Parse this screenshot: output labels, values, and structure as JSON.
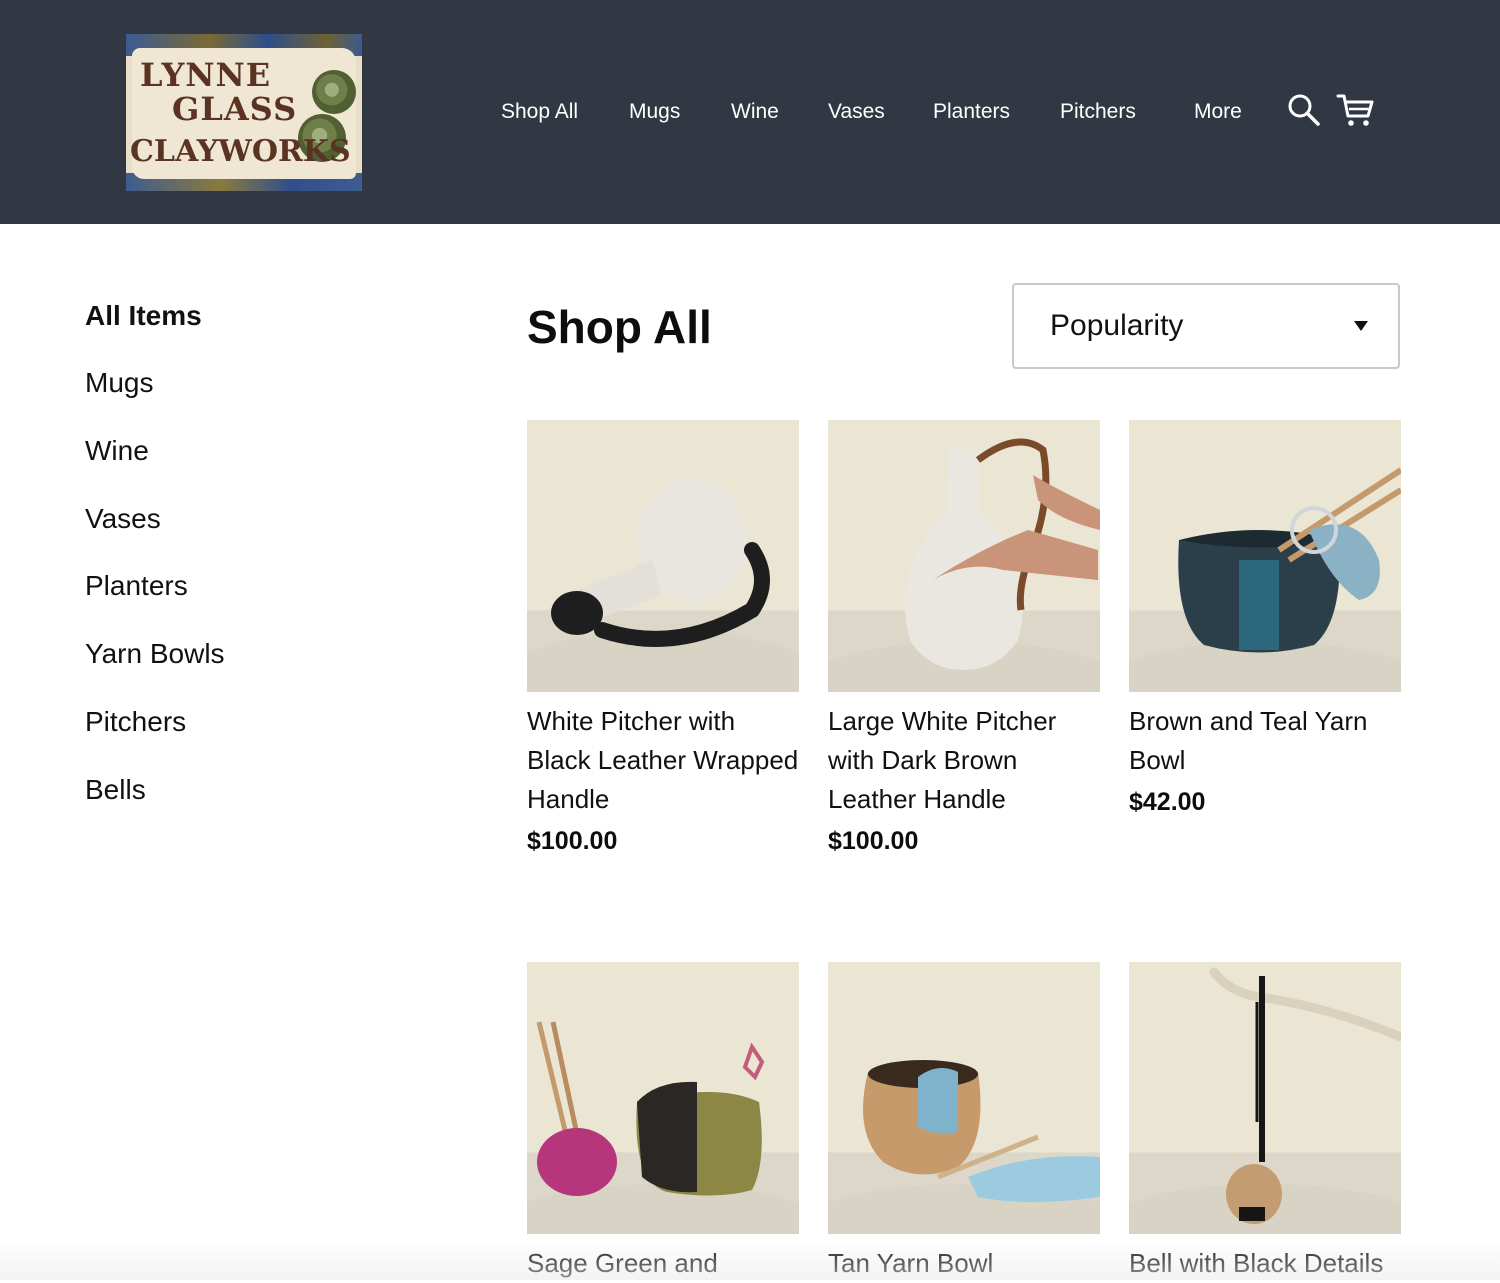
{
  "header": {
    "logo": {
      "lines": [
        "LYNNE",
        "GLASS",
        "CLAYWORKS"
      ]
    },
    "nav": [
      {
        "label": "Shop All"
      },
      {
        "label": "Mugs"
      },
      {
        "label": "Wine"
      },
      {
        "label": "Vases"
      },
      {
        "label": "Planters"
      },
      {
        "label": "Pitchers"
      },
      {
        "label": "More"
      }
    ],
    "icons": [
      "search-icon",
      "cart-icon"
    ],
    "colors": {
      "background": "#323843",
      "text": "#ffffff"
    }
  },
  "sidebar": {
    "items": [
      {
        "label": "All Items",
        "active": true
      },
      {
        "label": "Mugs"
      },
      {
        "label": "Wine"
      },
      {
        "label": "Vases"
      },
      {
        "label": "Planters"
      },
      {
        "label": "Yarn Bowls"
      },
      {
        "label": "Pitchers"
      },
      {
        "label": "Bells"
      }
    ]
  },
  "main": {
    "title": "Shop All",
    "sort": {
      "selected": "Popularity"
    },
    "products": [
      {
        "name": "White Pitcher with Black Leather Wrapped Handle",
        "price": "$100.00"
      },
      {
        "name": "Large White Pitcher with Dark Brown Leather Handle",
        "price": "$100.00"
      },
      {
        "name": "Brown and Teal Yarn Bowl",
        "price": "$42.00"
      },
      {
        "name": "Sage Green and",
        "price": ""
      },
      {
        "name": "Tan Yarn Bowl",
        "price": ""
      },
      {
        "name": "Bell with Black Details",
        "price": ""
      }
    ]
  }
}
